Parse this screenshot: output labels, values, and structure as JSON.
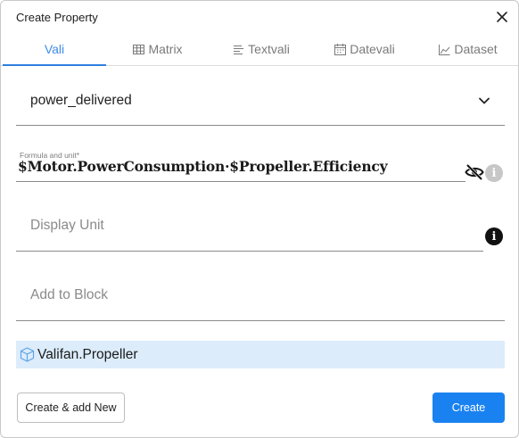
{
  "dialog": {
    "title": "Create Property",
    "close_icon": "close-icon"
  },
  "tabs": [
    {
      "label": "Vali",
      "icon": "",
      "active": true
    },
    {
      "label": "Matrix",
      "icon": "table-icon",
      "active": false
    },
    {
      "label": "Textvali",
      "icon": "text-lines-icon",
      "active": false
    },
    {
      "label": "Datevali",
      "icon": "calendar-icon",
      "active": false
    },
    {
      "label": "Dataset",
      "icon": "area-chart-icon",
      "active": false
    }
  ],
  "property_select": {
    "value": "power_delivered",
    "icon": "chevron-down-icon"
  },
  "formula": {
    "label": "Formula and unit*",
    "value": "$Motor.PowerConsumption·$Propeller.Efficiency",
    "visibility_icon": "eye-off-icon",
    "info_icon": "info-icon"
  },
  "display_unit": {
    "placeholder": "Display Unit",
    "info_icon": "info-icon"
  },
  "add_to_block": {
    "placeholder": "Add to Block"
  },
  "selected_block": {
    "label": "Valifan.Propeller",
    "icon": "cube-icon"
  },
  "actions": {
    "create_add_new": "Create & add New",
    "create": "Create"
  },
  "colors": {
    "accent": "#2f7fe0",
    "primary_button": "#1a82f0",
    "chip_background": "#dcecfb"
  }
}
